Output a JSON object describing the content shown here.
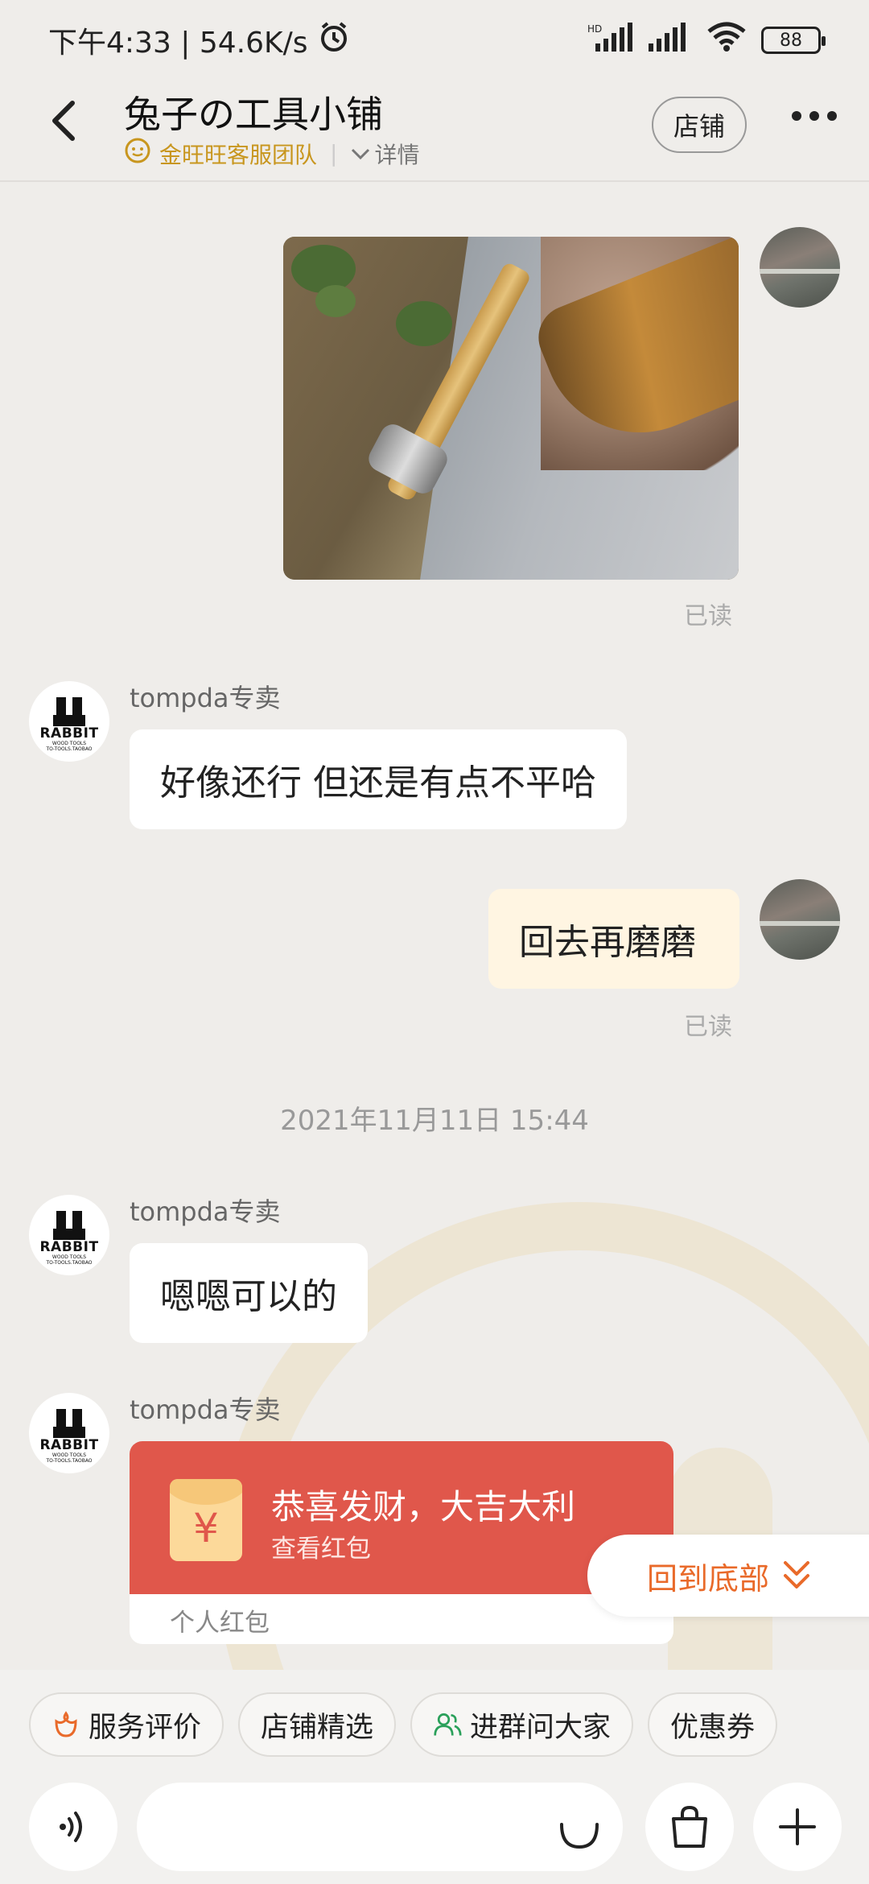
{
  "status_bar": {
    "time_speed": "下午4:33 | 54.6K/s",
    "battery": "88"
  },
  "header": {
    "title": "兔子の工具小铺",
    "team": "金旺旺客服团队",
    "detail": "详情",
    "store_button": "店铺"
  },
  "messages": {
    "read_label_1": "已读",
    "read_label_2": "已读",
    "sender_1": "tompda专卖",
    "text_1": "好像还行 但还是有点不平哈",
    "text_out_1": "回去再磨磨",
    "timestamp": "2021年11月11日 15:44",
    "sender_2": "tompda专卖",
    "text_2": "嗯嗯可以的",
    "sender_3": "tompda专卖"
  },
  "seller_avatar": {
    "brand": "RABBIT",
    "line1": "WOOD TOOLS",
    "line2": "TO-TOOLS.TAOBAO"
  },
  "red_packet": {
    "title": "恭喜发财，大吉大利",
    "subtitle": "查看红包",
    "footer": "个人红包",
    "symbol": "¥"
  },
  "back_to_bottom": "回到底部",
  "quick_actions": [
    {
      "label": "服务评价",
      "icon": "flower-icon"
    },
    {
      "label": "店铺精选",
      "icon": ""
    },
    {
      "label": "进群问大家",
      "icon": "group-icon"
    },
    {
      "label": "优惠券",
      "icon": ""
    }
  ],
  "input": {
    "placeholder": ""
  },
  "colors": {
    "accent_orange": "#e96a2a",
    "red_packet": "#e0574b",
    "team_gold": "#c8961e"
  }
}
